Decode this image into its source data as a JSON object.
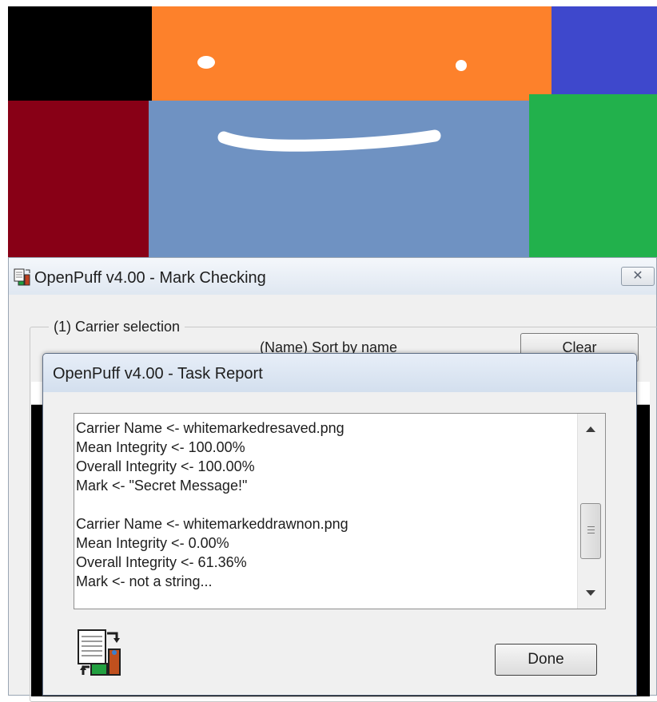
{
  "canvas_image": {
    "colors": {
      "black": "#000000",
      "orange": "#fd812b",
      "blue": "#3e48cc",
      "dark_red": "#880016",
      "steel_blue": "#6f92c2",
      "green": "#22b14c",
      "white": "#ffffff"
    }
  },
  "back_window": {
    "title": "OpenPuff v4.00 - Mark Checking",
    "close_icon": "close-icon",
    "group_label": "(1)  Carrier selection",
    "sort_label": "(Name) Sort by name",
    "clear_label": "Clear"
  },
  "dialog": {
    "title": "OpenPuff v4.00 - Task Report",
    "report_lines": [
      "Carrier Name <- whitemarkedresaved.png",
      "Mean Integrity <- 100.00%",
      "Overall Integrity <- 100.00%",
      "Mark <- \"Secret Message!\"",
      "",
      "Carrier Name <- whitemarkeddrawnon.png",
      "Mean Integrity <- 0.00%",
      "Overall Integrity <- 61.36%",
      "Mark <- not a string..."
    ],
    "done_label": "Done",
    "task_icon": "task-report-icon"
  }
}
